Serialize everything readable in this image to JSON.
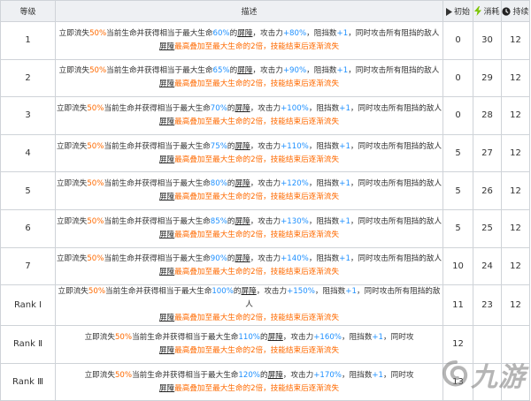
{
  "header": {
    "level": "等级",
    "description": "描述",
    "initial": "初始",
    "cost": "消耗",
    "duration": "持续"
  },
  "icons": {
    "initial": "play-triangle-icon",
    "cost": "lightning-icon",
    "duration": "clock-icon"
  },
  "colors": {
    "orange": "#ff6a00",
    "blue": "#1e90ff"
  },
  "rows": [
    {
      "level": "1",
      "p1": "立即流失",
      "hp_loss": "50%",
      "p2": "当前生命并获得相当于最大生命",
      "shield_pct": "60%",
      "p3": "的",
      "key": "屏障",
      "p4": "，攻击力",
      "atk": "+80%",
      "p5": "，阻挡数",
      "block": "+1",
      "p6": "，同时攻击所有阻挡的敌人",
      "key2": "屏障",
      "l2": "最高叠加至最大生命的2倍，技能结束后逐渐流失",
      "initial": "0",
      "cost": "30",
      "duration": "12"
    },
    {
      "level": "2",
      "p1": "立即流失",
      "hp_loss": "50%",
      "p2": "当前生命并获得相当于最大生命",
      "shield_pct": "65%",
      "p3": "的",
      "key": "屏障",
      "p4": "，攻击力",
      "atk": "+90%",
      "p5": "，阻挡数",
      "block": "+1",
      "p6": "，同时攻击所有阻挡的敌人",
      "key2": "屏障",
      "l2": "最高叠加至最大生命的2倍，技能结束后逐渐流失",
      "initial": "0",
      "cost": "29",
      "duration": "12"
    },
    {
      "level": "3",
      "p1": "立即流失",
      "hp_loss": "50%",
      "p2": "当前生命并获得相当于最大生命",
      "shield_pct": "70%",
      "p3": "的",
      "key": "屏障",
      "p4": "，攻击力",
      "atk": "+100%",
      "p5": "，阻挡数",
      "block": "+1",
      "p6": "，同时攻击所有阻挡的敌人",
      "key2": "屏障",
      "l2": "最高叠加至最大生命的2倍，技能结束后逐渐流失",
      "initial": "0",
      "cost": "28",
      "duration": "12"
    },
    {
      "level": "4",
      "p1": "立即流失",
      "hp_loss": "50%",
      "p2": "当前生命并获得相当于最大生命",
      "shield_pct": "75%",
      "p3": "的",
      "key": "屏障",
      "p4": "，攻击力",
      "atk": "+110%",
      "p5": "，阻挡数",
      "block": "+1",
      "p6": "，同时攻击所有阻挡的敌人",
      "key2": "屏障",
      "l2": "最高叠加至最大生命的2倍，技能结束后逐渐流失",
      "initial": "5",
      "cost": "27",
      "duration": "12"
    },
    {
      "level": "5",
      "p1": "立即流失",
      "hp_loss": "50%",
      "p2": "当前生命并获得相当于最大生命",
      "shield_pct": "80%",
      "p3": "的",
      "key": "屏障",
      "p4": "，攻击力",
      "atk": "+120%",
      "p5": "，阻挡数",
      "block": "+1",
      "p6": "，同时攻击所有阻挡的敌人",
      "key2": "屏障",
      "l2": "最高叠加至最大生命的2倍，技能结束后逐渐流失",
      "initial": "5",
      "cost": "26",
      "duration": "12"
    },
    {
      "level": "6",
      "p1": "立即流失",
      "hp_loss": "50%",
      "p2": "当前生命并获得相当于最大生命",
      "shield_pct": "85%",
      "p3": "的",
      "key": "屏障",
      "p4": "，攻击力",
      "atk": "+130%",
      "p5": "，阻挡数",
      "block": "+1",
      "p6": "，同时攻击所有阻挡的敌人",
      "key2": "屏障",
      "l2": "最高叠加至最大生命的2倍，技能结束后逐渐流失",
      "initial": "5",
      "cost": "25",
      "duration": "12"
    },
    {
      "level": "7",
      "p1": "立即流失",
      "hp_loss": "50%",
      "p2": "当前生命并获得相当于最大生命",
      "shield_pct": "90%",
      "p3": "的",
      "key": "屏障",
      "p4": "，攻击力",
      "atk": "+140%",
      "p5": "，阻挡数",
      "block": "+1",
      "p6": "，同时攻击所有阻挡的敌人",
      "key2": "屏障",
      "l2": "最高叠加至最大生命的2倍，技能结束后逐渐流失",
      "initial": "10",
      "cost": "24",
      "duration": "12"
    },
    {
      "level": "Rank Ⅰ",
      "p1": "立即流失",
      "hp_loss": "50%",
      "p2": "当前生命并获得相当于最大生命",
      "shield_pct": "100%",
      "p3": "的",
      "key": "屏障",
      "p4": "，攻击力",
      "atk": "+150%",
      "p5": "，阻挡数",
      "block": "+1",
      "p6": "，同时攻击所有阻挡的敌人",
      "key2": "屏障",
      "l2": "最高叠加至最大生命的2倍，技能结束后逐渐流失",
      "initial": "11",
      "cost": "23",
      "duration": "12"
    },
    {
      "level": "Rank Ⅱ",
      "p1": "立即流失",
      "hp_loss": "50%",
      "p2": "当前生命并获得相当于最大生命",
      "shield_pct": "110%",
      "p3": "的",
      "key": "屏障",
      "p4": "，攻击力",
      "atk": "+160%",
      "p5": "，阻挡数",
      "block": "+1",
      "p6": "，同时攻",
      "key2": "屏障",
      "l2": "最高叠加至最大生命的2倍，技能结束后逐渐流失",
      "initial": "12",
      "cost": "",
      "duration": ""
    },
    {
      "level": "Rank Ⅲ",
      "p1": "立即流失",
      "hp_loss": "50%",
      "p2": "当前生命并获得相当于最大生命",
      "shield_pct": "120%",
      "p3": "的",
      "key": "屏障",
      "p4": "，攻击力",
      "atk": "+170%",
      "p5": "，阻挡数",
      "block": "+1",
      "p6": "，同时攻",
      "key2": "屏障",
      "l2": "最高叠加至最大生命的2倍，技能结束后逐渐流失",
      "initial": "13",
      "cost": "",
      "duration": ""
    }
  ],
  "watermark": {
    "text": "九游"
  }
}
